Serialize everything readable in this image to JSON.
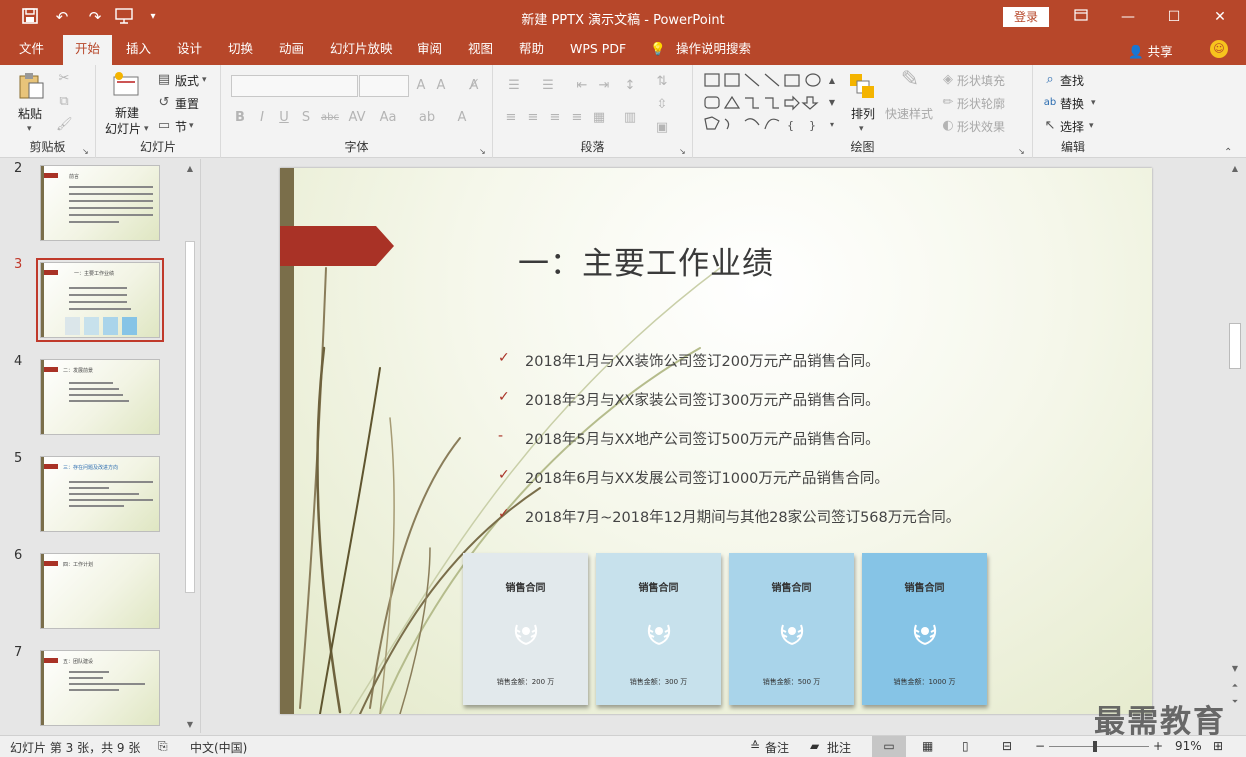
{
  "window": {
    "title": "新建 PPTX 演示文稿 - PowerPoint",
    "login": "登录"
  },
  "tabs": [
    "文件",
    "开始",
    "插入",
    "设计",
    "切换",
    "动画",
    "幻灯片放映",
    "审阅",
    "视图",
    "帮助",
    "WPS PDF",
    "操作说明搜索"
  ],
  "active_tab": "开始",
  "share": "共享",
  "ribbon": {
    "clipboard": {
      "paste": "粘贴",
      "group": "剪贴板"
    },
    "slides": {
      "new_slide_l1": "新建",
      "new_slide_l2": "幻灯片",
      "layout": "版式",
      "reset": "重置",
      "section": "节",
      "group": "幻灯片"
    },
    "font": {
      "group": "字体"
    },
    "paragraph": {
      "group": "段落"
    },
    "drawing": {
      "arrange": "排列",
      "quick_styles": "快速样式",
      "shape_fill": "形状填充",
      "shape_outline": "形状轮廓",
      "shape_effects": "形状效果",
      "group": "绘图"
    },
    "editing": {
      "find": "查找",
      "replace": "替换",
      "select": "选择",
      "group": "编辑"
    }
  },
  "thumbnails": [
    {
      "num": "2",
      "title": "前言",
      "selected": false
    },
    {
      "num": "3",
      "title": "一：主要工作业绩",
      "selected": true
    },
    {
      "num": "4",
      "title": "二：发展前景",
      "selected": false
    },
    {
      "num": "5",
      "title": "三：存在问题及改进方向",
      "selected": false
    },
    {
      "num": "6",
      "title": "四：工作计划",
      "selected": false
    },
    {
      "num": "7",
      "title": "五：团队建设",
      "selected": false
    }
  ],
  "slide": {
    "title": "一：主要工作业绩",
    "bullets": [
      {
        "marker": "✓",
        "text": "2018年1月与XX装饰公司签订200万元产品销售合同。"
      },
      {
        "marker": "✓",
        "text": "2018年3月与XX家装公司签订300万元产品销售合同。"
      },
      {
        "marker": "-",
        "text": "2018年5月与XX地产公司签订500万元产品销售合同。"
      },
      {
        "marker": "✓",
        "text": "2018年6月与XX发展公司签订1000万元产品销售合同。"
      },
      {
        "marker": "✓",
        "text": "2018年7月~2018年12月期间与其他28家公司签订568万元合同。"
      }
    ],
    "cards": [
      {
        "title": "销售合同",
        "amount": "销售金额：200 万",
        "color": "#e2e9ec"
      },
      {
        "title": "销售合同",
        "amount": "销售金额：300 万",
        "color": "#c7e1ec"
      },
      {
        "title": "销售合同",
        "amount": "销售金额：500 万",
        "color": "#a9d4ea"
      },
      {
        "title": "销售合同",
        "amount": "销售金额：1000 万",
        "color": "#86c4e6"
      }
    ]
  },
  "watermark": "最需教育",
  "statusbar": {
    "slide_info": "幻灯片 第 3 张，共 9 张",
    "language": "中文(中国)",
    "notes": "备注",
    "comments": "批注",
    "zoom": "91%"
  },
  "colors": {
    "accent": "#b7472a",
    "bar": "#7a6e4a",
    "flag": "#a93226"
  }
}
